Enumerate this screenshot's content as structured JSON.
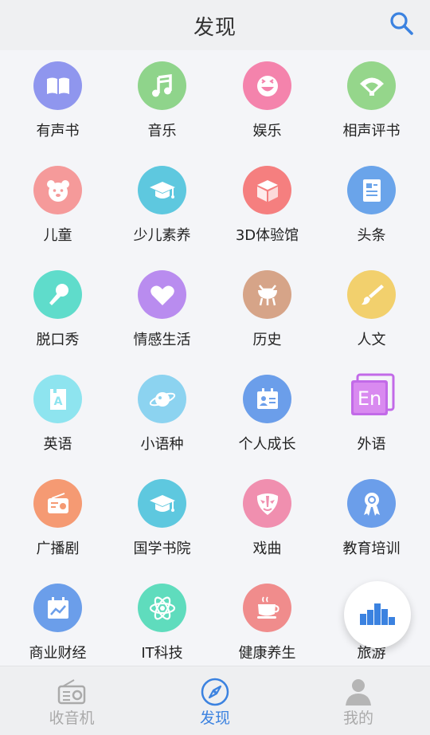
{
  "header": {
    "title": "发现"
  },
  "categories": [
    {
      "label": "有声书",
      "icon": "book-icon",
      "color": "#8f96ee"
    },
    {
      "label": "音乐",
      "icon": "music-note-icon",
      "color": "#8fd48b"
    },
    {
      "label": "娱乐",
      "icon": "smile-face-icon",
      "color": "#f483ac"
    },
    {
      "label": "相声评书",
      "icon": "fan-icon",
      "color": "#95d68b"
    },
    {
      "label": "儿童",
      "icon": "bear-icon",
      "color": "#f59a9a"
    },
    {
      "label": "少儿素养",
      "icon": "graduation-cap-icon",
      "color": "#5ec8df"
    },
    {
      "label": "3D体验馆",
      "icon": "cube-icon",
      "color": "#f57f7f"
    },
    {
      "label": "头条",
      "icon": "newspaper-icon",
      "color": "#6aa4ea"
    },
    {
      "label": "脱口秀",
      "icon": "microphone-icon",
      "color": "#5fdccb"
    },
    {
      "label": "情感生活",
      "icon": "heart-icon",
      "color": "#b98cef"
    },
    {
      "label": "历史",
      "icon": "ancient-vessel-icon",
      "color": "#d6a488"
    },
    {
      "label": "人文",
      "icon": "paintbrush-icon",
      "color": "#f2d06d"
    },
    {
      "label": "英语",
      "icon": "letter-a-card-icon",
      "color": "#8ee4ef"
    },
    {
      "label": "小语种",
      "icon": "planet-icon",
      "color": "#8cd3f0"
    },
    {
      "label": "个人成长",
      "icon": "id-card-icon",
      "color": "#6b9eea"
    },
    {
      "label": "外语",
      "icon": "en-badge-icon",
      "color": "#c26ae8"
    },
    {
      "label": "广播剧",
      "icon": "radio-icon",
      "color": "#f59a73"
    },
    {
      "label": "国学书院",
      "icon": "graduation-cap-icon",
      "color": "#5ec8df"
    },
    {
      "label": "戏曲",
      "icon": "opera-mask-icon",
      "color": "#f08faf"
    },
    {
      "label": "教育培训",
      "icon": "award-ribbon-icon",
      "color": "#6b9eea"
    },
    {
      "label": "商业财经",
      "icon": "calendar-chart-icon",
      "color": "#6b9eea"
    },
    {
      "label": "IT科技",
      "icon": "atom-icon",
      "color": "#5fdcbd"
    },
    {
      "label": "健康养生",
      "icon": "tea-cup-icon",
      "color": "#f08c8c"
    },
    {
      "label": "旅游",
      "icon": "travel-icon",
      "color": "#a8d8f0"
    }
  ],
  "tabs": [
    {
      "label": "收音机",
      "icon": "radio-tab-icon",
      "active": false
    },
    {
      "label": "发现",
      "icon": "compass-icon",
      "active": true
    },
    {
      "label": "我的",
      "icon": "person-icon",
      "active": false
    }
  ],
  "colors": {
    "accent": "#3b82e0",
    "inactive": "#aaaaaa"
  }
}
